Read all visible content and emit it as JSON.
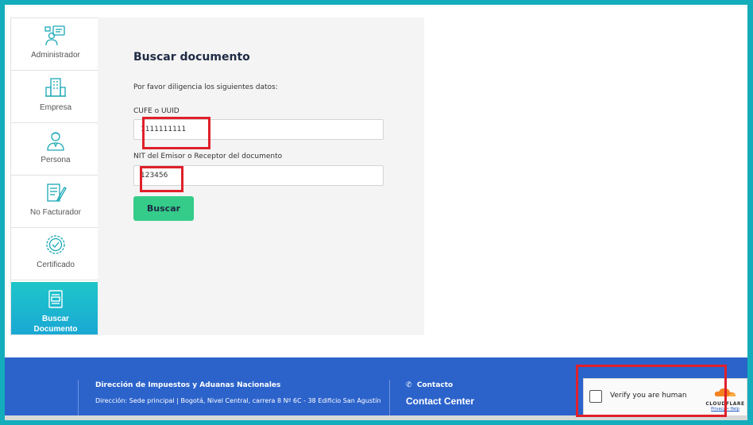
{
  "sidebar": {
    "items": [
      {
        "label": "Administrador",
        "icon": "admin-icon",
        "active": false
      },
      {
        "label": "Empresa",
        "icon": "building-icon",
        "active": false
      },
      {
        "label": "Persona",
        "icon": "person-icon",
        "active": false
      },
      {
        "label": "No Facturador",
        "icon": "document-edit-icon",
        "active": false
      },
      {
        "label": "Certificado",
        "icon": "certificate-badge-icon",
        "active": false
      },
      {
        "label_line1": "Buscar",
        "label_line2": "Documento",
        "icon": "document-search-icon",
        "active": true
      }
    ]
  },
  "form": {
    "title": "Buscar documento",
    "instructions": "Por favor diligencia los siguientes datos:",
    "cufe_label": "CUFE o UUID",
    "cufe_value": "1111111111",
    "nit_label": "NIT del Emisor o Receptor del documento",
    "nit_value": "123456",
    "submit_label": "Buscar"
  },
  "footer": {
    "org_name": "Dirección de Impuestos y Aduanas Nacionales",
    "address": "Dirección: Sede principal | Bogotá, Nivel Central, carrera 8 Nº 6C - 38 Edificio San Agustín",
    "contact_heading": "Contacto",
    "contact_center": "Contact Center"
  },
  "captcha": {
    "label": "Verify you are human",
    "brand": "CLOUDFLARE",
    "privacy": "Privacy",
    "help": "Help"
  },
  "colors": {
    "page_border": "#14adbb",
    "accent_green": "#35cc8a",
    "active_tab": "#1ec6c9",
    "footer_blue": "#2c63cb",
    "highlight_red": "#e0202a"
  }
}
